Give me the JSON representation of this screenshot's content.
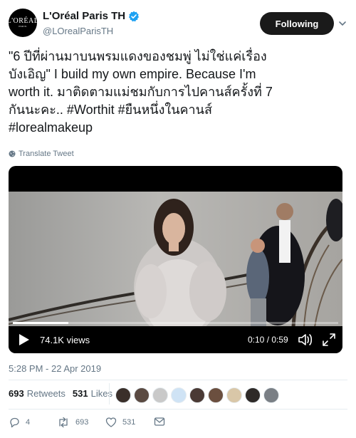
{
  "account": {
    "display_name": "L'Oréal Paris TH",
    "handle": "@LOrealParisTH",
    "avatar_text": "L'ORÉAL",
    "avatar_subtext": "PARIS",
    "follow_label": "Following"
  },
  "tweet": {
    "text": "\"6 ปีที่ผ่านมาบนพรมแดงของชมพู่ ไม่ใช่แค่เรื่อง\nบังเอิญ\" I build my own empire. Because I'm\nworth it. มาติดตามแม่ชมกับการไปคานส์ครั้งที่ 7\nกันนะคะ.. #Worthit #ยืนหนึ่งในคานส์\n#lorealmakeup",
    "translate_label": "Translate Tweet",
    "timestamp": "5:28 PM - 22 Apr 2019"
  },
  "video": {
    "views": "74.1K views",
    "time": "0:10 / 0:59",
    "progress_fraction": 0.17
  },
  "stats": {
    "retweets_count": "693",
    "retweets_label": "Retweets",
    "likes_count": "531",
    "likes_label": "Likes",
    "liker_colors": [
      "#3a2f2a",
      "#5a4a42",
      "#c9c9c9",
      "#cfe3f5",
      "#4a3a35",
      "#6b4f3f",
      "#d9c7a8",
      "#2e2a28",
      "#7a7f85"
    ]
  },
  "actions": {
    "replies": "4",
    "retweets": "693",
    "likes": "531"
  },
  "colors": {
    "verified": "#1da1f2",
    "muted": "#657786",
    "text": "#14171a"
  }
}
